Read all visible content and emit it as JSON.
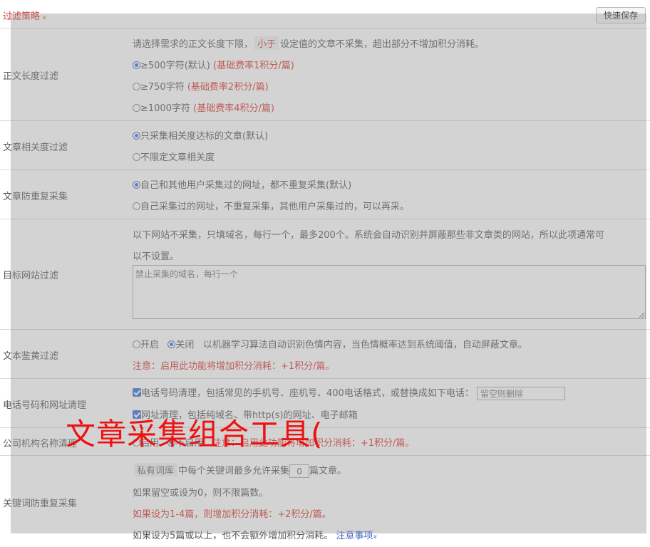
{
  "header": {
    "title": "过滤策略",
    "chevron": "»",
    "quick_save": "快速保存"
  },
  "length_filter": {
    "label": "正文长度过滤",
    "desc_before": "请选择需求的正文长度下限，",
    "desc_tag": "小于",
    "desc_after": "设定值的文章不采集，超出部分不增加积分消耗。",
    "options": [
      {
        "text": "≥500字符(默认)",
        "note": "(基础费率1积分/篇)",
        "checked": true
      },
      {
        "text": "≥750字符",
        "note": "(基础费率2积分/篇)",
        "checked": false
      },
      {
        "text": "≥1000字符",
        "note": "(基础费率4积分/篇)",
        "checked": false
      }
    ]
  },
  "relevance_filter": {
    "label": "文章相关度过滤",
    "options": [
      {
        "text": "只采集相关度达标的文章(默认)",
        "checked": true
      },
      {
        "text": "不限定文章相关度",
        "checked": false
      }
    ]
  },
  "dedupe": {
    "label": "文章防重复采集",
    "options": [
      {
        "text": "自己和其他用户采集过的网址，都不重复采集(默认)",
        "checked": true
      },
      {
        "text": "自己采集过的网址，不重复采集，其他用户采集过的，可以再采。",
        "checked": false
      }
    ]
  },
  "site_filter": {
    "label": "目标网站过滤",
    "desc_line1": "以下网站不采集，只填域名，每行一个，最多200个。系统会自动识别并屏蔽那些非文章类的网站，所以此项通常可",
    "desc_line2": "以不设置。",
    "placeholder": "禁止采集的域名，每行一个"
  },
  "porn_filter": {
    "label": "文本鉴黄过滤",
    "on_label": "开启",
    "off_label": "关闭",
    "selected": "关闭",
    "desc": "以机器学习算法自动识别色情内容，当色情概率达到系统阈值，自动屏蔽文章。",
    "note": "注意：启用此功能将增加积分消耗：+1积分/篇。"
  },
  "phone_url": {
    "label": "电话号码和网址清理",
    "phone_text": "电话号码清理，包括常见的手机号、座机号、400电话格式，或替换成如下电话：",
    "phone_placeholder": "留空则删除",
    "url_text": "网址清理，包括纯域名、带http(s)的网址、电子邮箱"
  },
  "org_names": {
    "label": "公司机构名称清理",
    "on_label": "启用",
    "off_label": "不启用",
    "selected": "不启用",
    "note": "注意：启用此功能将增加积分消耗：+1积分/篇。"
  },
  "keyword_dedupe": {
    "label": "关键词防重复采集",
    "tag": "私有词库",
    "text_before": "中每个关键词最多允许采集",
    "value": "0",
    "text_after": "篇文章。",
    "line2": "如果留空或设为0，则不限篇数。",
    "line3": "如果设为1-4篇，则增加积分消耗：+2积分/篇。",
    "line4": "如果设为5篇或以上，也不会额外增加积分消耗。",
    "link": "注意事项",
    "link_chevron": "»"
  },
  "watermark": "文章采集组合工具("
}
